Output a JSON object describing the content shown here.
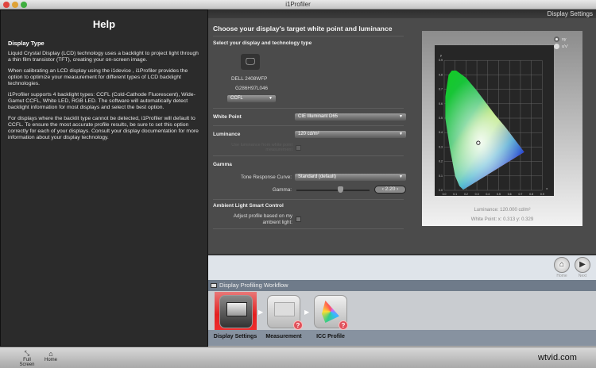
{
  "window": {
    "title": "i1Profiler"
  },
  "help": {
    "title": "Help",
    "heading": "Display Type",
    "paragraphs": [
      "Liquid Crystal Display (LCD) technology uses a backlight to project light through a thin film transistor (TFT), creating your on-screen image.",
      "When calibrating an LCD display using the i1device , i1Profiler provides the option to optimize your measurement for different types of LCD backlight technologies.",
      "i1Profiler supports 4 backlight types: CCFL (Cold-Cathode Fluorescent), Wide-Gamut CCFL, White LED, RGB LED. The software will automatically detect backlight information for most displays and select the best option.",
      "For displays where the backlit type cannot be detected, i1Profiler will default to CCFL. To ensure the most accurate profile results, be sure to set this option correctly for each of your displays. Consult your display documentation for more information about your display technology."
    ]
  },
  "panel": {
    "header": "Display Settings",
    "title": "Choose your display's target white point and luminance"
  },
  "display": {
    "section": "Select your display and technology type",
    "model": "DELL 2408WFP",
    "serial": "G286H97L046",
    "technology": "CCFL"
  },
  "white_point": {
    "label": "White Point",
    "value": "CIE Illuminant D65"
  },
  "luminance": {
    "label": "Luminance",
    "value": "120 cd/m²",
    "option": "Use luminance from white point measurement"
  },
  "gamma": {
    "section": "Gamma",
    "trc_label": "Tone Response Curve:",
    "trc_value": "Standard (default)",
    "gamma_label": "Gamma:",
    "gamma_value": "2.20",
    "slider_fraction": 0.6
  },
  "ambient": {
    "section": "Ambient Light Smart Control",
    "option": "Adjust profile based on my ambient light:"
  },
  "chart": {
    "mode_options": [
      "xy",
      "u'v'"
    ],
    "selected": "xy",
    "x_axis": "x",
    "y_axis": "y",
    "ticks": [
      "0.0",
      "0.1",
      "0.2",
      "0.3",
      "0.4",
      "0.5",
      "0.6",
      "0.7",
      "0.8",
      "0.9"
    ],
    "white_point": [
      0.313,
      0.329
    ],
    "luminance_text": "Luminance: 120.000 cd/m²",
    "white_point_text": "White Point: x: 0.313  y: 0.329"
  },
  "nav": {
    "home": "Home",
    "next": "Next"
  },
  "workflow": {
    "title": "Display Profiling Workflow",
    "steps": [
      "Display Settings",
      "Measurement",
      "ICC Profile"
    ]
  },
  "bottom": {
    "fullscreen": "Full Screen",
    "home": "Home"
  },
  "watermark": "wtvid.com"
}
